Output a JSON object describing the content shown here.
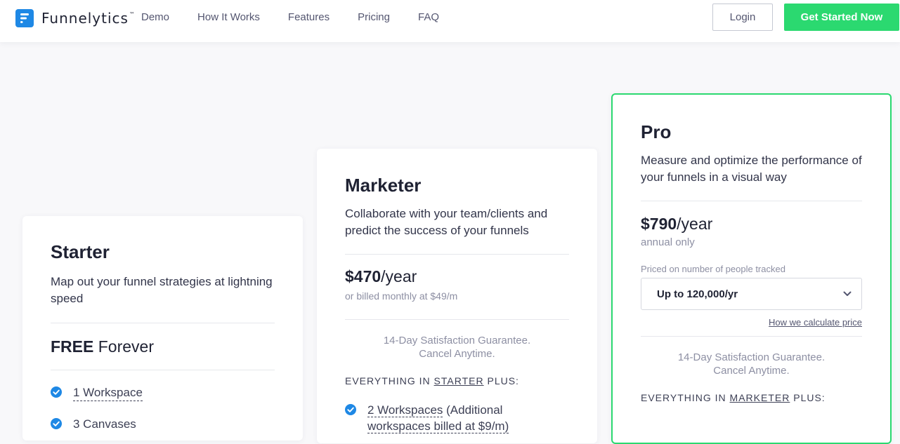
{
  "brand": {
    "name": "Funnelytics",
    "tm": "™",
    "logo_color": "#1e88e5"
  },
  "nav": {
    "items": [
      "Demo",
      "How It Works",
      "Features",
      "Pricing",
      "FAQ"
    ]
  },
  "header": {
    "login_label": "Login",
    "start_label": "Get Started Now",
    "accent": "#2bd970"
  },
  "plans": {
    "starter": {
      "name": "Starter",
      "desc": "Map out your funnel strategies at lightning speed",
      "price_bold": "FREE",
      "price_rest": " Forever",
      "features": [
        "1 Workspace",
        "3 Canvases"
      ]
    },
    "marketer": {
      "name": "Marketer",
      "desc": "Collaborate with your team/clients and predict the success of your funnels",
      "price_bold": "$470",
      "price_rest": "/year",
      "price_sub": "or billed monthly at $49/m",
      "guarantee_line1": "14-Day Satisfaction Guarantee.",
      "guarantee_line2": "Cancel Anytime.",
      "everything_pre": "EVERYTHING IN ",
      "everything_link": "STARTER",
      "everything_post": " PLUS:",
      "feature1_link": "2 Workspaces",
      "feature1_rest": " (Additional",
      "feature1_line2": "workspaces billed at $9/m)"
    },
    "pro": {
      "name": "Pro",
      "desc": "Measure and optimize the performance of your funnels in a visual way",
      "price_bold": "$790",
      "price_rest": "/year",
      "price_sub": "annual only",
      "tracked_label": "Priced on number of people tracked",
      "select_value": "Up to 120,000/yr",
      "calc_link": "How we calculate price",
      "guarantee_line1": "14-Day Satisfaction Guarantee.",
      "guarantee_line2": "Cancel Anytime.",
      "everything_pre": "EVERYTHING IN ",
      "everything_link": "MARKETER",
      "everything_post": " PLUS:"
    }
  },
  "colors": {
    "check": "#1e88e5",
    "accent": "#2bd970"
  }
}
